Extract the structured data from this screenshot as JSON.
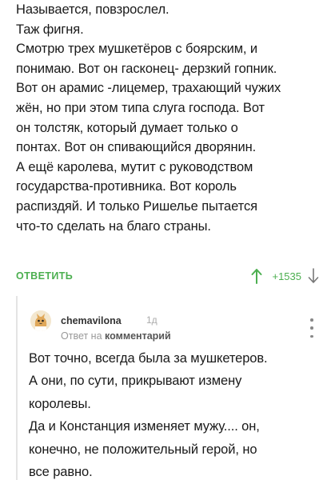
{
  "comment": {
    "lines": [
      "Называется, повзрослел.",
      "Таж фигня.",
      "Смотрю трех мушкетёров с боярским, и",
      "понимаю. Вот он гасконец- дерзкий гопник.",
      "Вот он арамис -лицемер, трахающий чужих",
      "жён, но при этом типа слуга господа. Вот",
      "он толстяк, который думает только о",
      "понтах. Вот он спивающийся дворянин.",
      "А ещё каролева, мутит с руководством",
      "государства-противника. Вот король",
      "распиздяй. И только Ришелье пытается",
      "что-то сделать на благо страны."
    ],
    "reply_label": "ОТВЕТИТЬ",
    "score": "+1535",
    "upvote_icon": "arrow-up-icon",
    "downvote_icon": "arrow-down-icon"
  },
  "reply": {
    "author": "chemavilona",
    "age": "1д",
    "reply_to_prefix": "Ответ на",
    "reply_to_target": "комментарий",
    "avatar_icon": "cat-avatar-icon",
    "menu_icon": "more-vertical-icon",
    "lines": [
      "Вот точно, всегда была за мушкетеров.",
      "А они, по сути, прикрывают измену",
      "королевы.",
      "Да и Констанция изменяет мужу.... он,",
      "конечно, не положительный герой, но",
      "все равно."
    ]
  },
  "colors": {
    "accent": "#4caf50",
    "text": "#1a1a1a",
    "muted": "#999999",
    "thread_line": "#e4e4e4"
  }
}
